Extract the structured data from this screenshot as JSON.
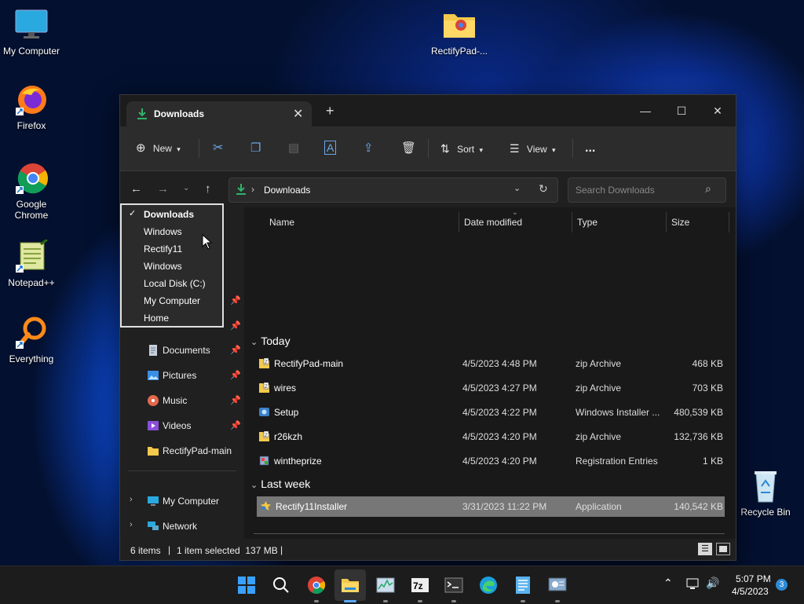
{
  "desktop": {
    "icons": [
      {
        "label": "My Computer"
      },
      {
        "label": "Firefox"
      },
      {
        "label": "Google Chrome"
      },
      {
        "label": "Notepad++"
      },
      {
        "label": "Everything"
      },
      {
        "label": "RectifyPad-..."
      },
      {
        "label": "Recycle Bin"
      }
    ]
  },
  "window": {
    "tab_title": "Downloads",
    "commands": {
      "new": "New",
      "sort": "Sort",
      "view": "View",
      "more": "..."
    },
    "address": {
      "path": "Downloads",
      "search_placeholder": "Search Downloads"
    },
    "location_dropdown": {
      "items": [
        {
          "label": "Downloads",
          "checked": true
        },
        {
          "label": "Windows",
          "checked": false
        },
        {
          "label": "Rectify11",
          "checked": false
        },
        {
          "label": "Windows",
          "checked": false
        },
        {
          "label": "Local Disk (C:)",
          "checked": false
        },
        {
          "label": "My Computer",
          "checked": false
        },
        {
          "label": "Home",
          "checked": false
        }
      ]
    },
    "sidebar": {
      "items": [
        {
          "label": "Documents",
          "icon": "documents-icon",
          "pinned": true
        },
        {
          "label": "Pictures",
          "icon": "pictures-icon",
          "pinned": true
        },
        {
          "label": "Music",
          "icon": "music-icon",
          "pinned": true
        },
        {
          "label": "Videos",
          "icon": "videos-icon",
          "pinned": true
        },
        {
          "label": "RectifyPad-main",
          "icon": "folder-icon",
          "pinned": false
        },
        {
          "label": "My Computer",
          "icon": "computer-icon",
          "pinned": false
        },
        {
          "label": "Network",
          "icon": "network-icon",
          "pinned": false
        }
      ]
    },
    "columns": {
      "name": "Name",
      "date": "Date modified",
      "type": "Type",
      "size": "Size"
    },
    "groups": [
      {
        "label": "Today",
        "files": [
          {
            "name": "RectifyPad-main",
            "date": "4/5/2023 4:48 PM",
            "type": "zip Archive",
            "size": "468 KB",
            "icon": "zip-icon"
          },
          {
            "name": "wires",
            "date": "4/5/2023 4:27 PM",
            "type": "zip Archive",
            "size": "703 KB",
            "icon": "zip-icon"
          },
          {
            "name": "Setup",
            "date": "4/5/2023 4:22 PM",
            "type": "Windows Installer ...",
            "size": "480,539 KB",
            "icon": "installer-icon"
          },
          {
            "name": "r26kzh",
            "date": "4/5/2023 4:20 PM",
            "type": "zip Archive",
            "size": "132,736 KB",
            "icon": "zip-icon"
          },
          {
            "name": "wintheprize",
            "date": "4/5/2023 4:20 PM",
            "type": "Registration Entries",
            "size": "1 KB",
            "icon": "registry-icon"
          }
        ]
      },
      {
        "label": "Last week",
        "files": [
          {
            "name": "Rectify11Installer",
            "date": "3/31/2023 11:22 PM",
            "type": "Application",
            "size": "140,542 KB",
            "icon": "app-icon",
            "selected": true
          }
        ]
      }
    ],
    "status": {
      "items": "6 items",
      "selected": "1 item selected  137 MB"
    }
  },
  "taskbar": {
    "time": "5:07 PM",
    "date": "4/5/2023",
    "notifications": "3"
  },
  "colors": {
    "accent": "#2fb36a",
    "selected_row": "#777777",
    "window_bg": "#202020"
  }
}
